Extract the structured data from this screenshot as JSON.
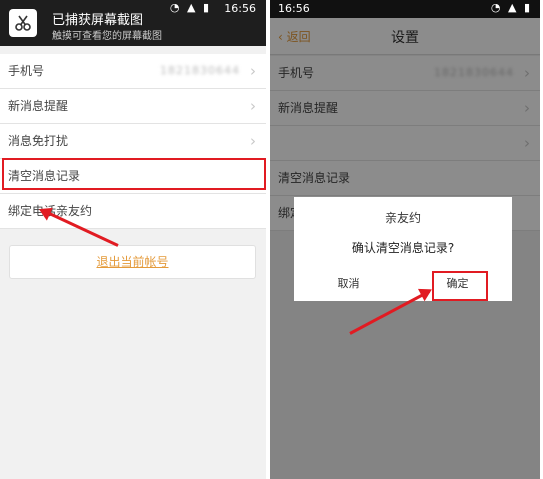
{
  "left": {
    "notification": {
      "title": "已捕获屏幕截图",
      "subtitle": "触摸可查看您的屏幕截图"
    },
    "status": {
      "time": "16:56"
    },
    "settings": [
      {
        "label": "手机号",
        "value": "1821830644",
        "chevron": "›"
      },
      {
        "label": "新消息提醒",
        "chevron": "›"
      },
      {
        "label": "消息免打扰",
        "chevron": "›"
      },
      {
        "label": "清空消息记录"
      },
      {
        "label": "绑定电话亲友约"
      }
    ],
    "logout_label": "退出当前帐号"
  },
  "right": {
    "status": {
      "time": "16:56"
    },
    "header": {
      "back_label": "返回",
      "title": "设置"
    },
    "settings": [
      {
        "label": "手机号",
        "value": "1821830644",
        "chevron": "›"
      },
      {
        "label": "新消息提醒",
        "chevron": "›"
      },
      {
        "label": "",
        "chevron": "›"
      },
      {
        "label": "清空消息记录"
      },
      {
        "label": "绑定"
      }
    ],
    "dialog": {
      "title": "亲友约",
      "message": "确认清空消息记录?",
      "cancel_label": "取消",
      "ok_label": "确定"
    }
  },
  "colors": {
    "accent": "#e49a3a",
    "highlight_red": "#e11b22"
  }
}
